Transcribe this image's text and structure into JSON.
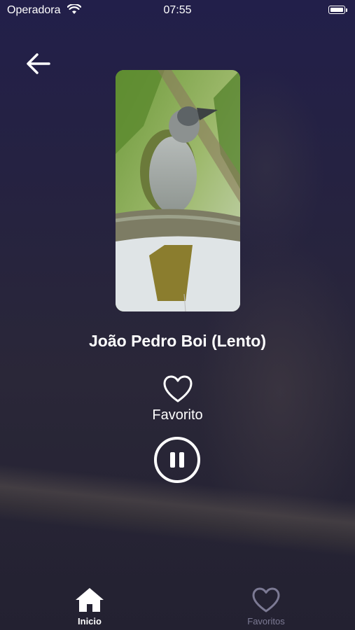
{
  "status_bar": {
    "carrier": "Operadora",
    "time": "07:55"
  },
  "player": {
    "title": "João Pedro Boi (Lento)",
    "favorite_label": "Favorito"
  },
  "tab_bar": {
    "home_label": "Inicio",
    "favorites_label": "Favoritos",
    "active_color": "#ffffff",
    "inactive_color": "#7c7a94"
  },
  "icons": [
    "back-arrow-icon",
    "heart-outline-icon",
    "pause-icon",
    "home-icon",
    "heart-icon"
  ]
}
